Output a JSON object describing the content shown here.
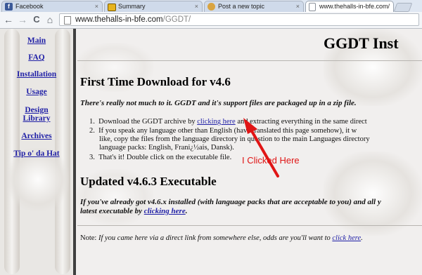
{
  "tabs": [
    {
      "label": "Facebook",
      "active": false
    },
    {
      "label": "Summary",
      "active": false
    },
    {
      "label": "Post a new topic",
      "active": false
    },
    {
      "label": "www.thehalls-in-bfe.com/",
      "active": true
    }
  ],
  "tab_close_glyph": "×",
  "toolbar": {
    "back_glyph": "←",
    "forward_glyph": "→",
    "reload_glyph": "C",
    "home_glyph": "⌂",
    "url_domain": "www.thehalls-in-bfe.com",
    "url_path": "/GGDT/"
  },
  "sidebar": {
    "items": [
      {
        "label": "Main"
      },
      {
        "label": "FAQ"
      },
      {
        "label": "Installation"
      },
      {
        "label": "Usage"
      },
      {
        "label": "Design Library"
      },
      {
        "label": "Archives"
      },
      {
        "label": "Tip o' da Hat"
      }
    ]
  },
  "content": {
    "title": "GGDT Inst",
    "section1": {
      "heading": "First Time Download for v4.6",
      "intro": "There's really not much to it. GGDT and it's support files are packaged up in a zip file.",
      "steps": [
        {
          "num": "1.",
          "before": "Download the GGDT archive by ",
          "link": "clicking here",
          "after": " and extracting everything in the same direct"
        },
        {
          "num": "2.",
          "before": "If you speak any language other than English (",
          "link": "",
          "after": "have translated this page somehow), it w"
        },
        {
          "num": "",
          "before": "like, copy the files from the language directory in question to the main Languages directory",
          "link": "",
          "after": ""
        },
        {
          "num": "",
          "before": "language packs: English, Frani¿½ais, Dansk).",
          "link": "",
          "after": ""
        },
        {
          "num": "3.",
          "before": "That's it! Double click on the executable file.",
          "link": "",
          "after": ""
        }
      ]
    },
    "section2": {
      "heading": "Updated v4.6.3 Executable",
      "line1": "If you've already got v4.6.x installed (with language packs that are acceptable to you) and all y",
      "line2_before": "latest executable by ",
      "line2_link": "clicking here",
      "line2_after": "."
    },
    "note": {
      "label": "Note: ",
      "text": "If you came here via a direct link from somewhere else, odds are you'll want to ",
      "link": "click here",
      "after": "."
    }
  },
  "annotation": {
    "text": "I Clicked Here",
    "color": "#e01515"
  }
}
